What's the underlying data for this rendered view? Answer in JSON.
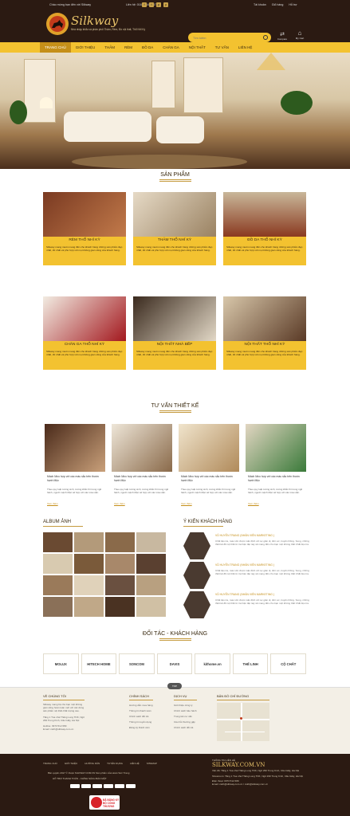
{
  "topbar": {
    "welcome": "Chào mừng bạn đến với Silkway",
    "hotline": "Liên hệ: 0167 244 3737",
    "social": [
      "f",
      "t",
      "p",
      "y"
    ],
    "links": [
      "Tài khoản",
      "Giỏ hàng",
      "Hỗ trợ"
    ]
  },
  "header": {
    "brand": "Silkway",
    "slogan": "Nhà nhập khẩu và phân phối Thảm, Rèm, Đồ nội thất, Thổ Nhĩ Kỳ",
    "search_placeholder": "Tìm kiếm",
    "compare_label": "Compare",
    "cart_label": "My Cart",
    "cart_count": "0"
  },
  "nav": {
    "items": [
      "TRANG CHỦ",
      "GIỚI THIỆU",
      "THẢM",
      "RÈM",
      "ĐỒ DA",
      "CHĂN GA",
      "NỘI THẤT",
      "TƯ VẤN",
      "LIÊN HỆ"
    ],
    "active_index": 0
  },
  "products": {
    "title": "SẢN PHẨM",
    "items": [
      {
        "name": "RÈM THỔ NHĨ KỲ",
        "desc": "Silkway mang muôn mang đến cho khách hàng những sản phẩm đẹp nhất, tốt nhất và phù hợp với mọi không gian sống của khách hàng."
      },
      {
        "name": "THẢM THỔ NHĨ KỲ",
        "desc": "Silkway mang muôn mang đến cho khách hàng những sản phẩm đẹp nhất, tốt nhất và phù hợp với mọi không gian sống của khách hàng."
      },
      {
        "name": "ĐỒ DA THỔ NHĨ KỲ",
        "desc": "Silkway mang muôn mang đến cho khách hàng những sản phẩm đẹp nhất, tốt nhất và phù hợp với mọi không gian sống của khách hàng."
      },
      {
        "name": "CHĂN GA THỔ NHĨ KỲ",
        "desc": "Silkway mang muôn mang đến cho khách hàng những sản phẩm đẹp nhất, tốt nhất và phù hợp với mọi không gian sống của khách hàng."
      },
      {
        "name": "NỘI THẤT NHÀ BẾP",
        "desc": "Silkway mang muôn mang đến cho khách hàng những sản phẩm đẹp nhất, tốt nhất và phù hợp với mọi không gian sống của khách hàng."
      },
      {
        "name": "NỘI THẤT THỔ NHĨ KỲ",
        "desc": "Silkway mang muôn mang đến cho khách hàng những sản phẩm đẹp nhất, tốt nhất và phù hợp với mọi không gian sống của khách hàng."
      }
    ]
  },
  "advice": {
    "title": "TƯ VẤN THIẾT KẾ",
    "items": [
      {
        "title": "Mách Mẹo hợp với các màu sắc trên thước hạnh Mộc",
        "desc": "Theo quy luật tương sinh, tương khắc thì trong ngũ hành, người mệnh Mộc sẽ hợp với các màu sắc.",
        "more": "Xem thêm"
      },
      {
        "title": "Mách Mẹo hợp với các màu sắc trên thước hạnh Mộc",
        "desc": "Theo quy luật tương sinh, tương khắc thì trong ngũ hành, người mệnh Mộc sẽ hợp với các màu sắc.",
        "more": "Xem thêm"
      },
      {
        "title": "Mách Mẹo hợp với các màu sắc trên thước hạnh Mộc",
        "desc": "Theo quy luật tương sinh, tương khắc thì trong ngũ hành, người mệnh Mộc sẽ hợp với các màu sắc.",
        "more": "Xem thêm"
      },
      {
        "title": "Mách Mẹo hợp với các màu sắc trên thước hạnh Mộc",
        "desc": "Theo quy luật tương sinh, tương khắc thì trong ngũ hành, người mệnh Mộc sẽ hợp với các màu sắc.",
        "more": "Xem thêm"
      }
    ]
  },
  "album": {
    "title": "ALBUM ẢNH"
  },
  "feedback": {
    "title": "Ý KIẾN KHÁCH HÀNG",
    "items": [
      {
        "name": "VŨ HUYỀN TRANG (NHÂN VIÊN MARKETING )",
        "text": "Chất liệu tra, màu vốn được mặc định với sự giản dị, đơn sơ, truyền thống. Song, những thiết kế đồ nội thất từ tra hiện đại này sẽ mang đến cho bạn một không thất Chất liệu tra."
      },
      {
        "name": "VŨ HUYỀN TRANG (NHÂN VIÊN MARKETING )",
        "text": "Chất liệu tra, màu vốn được mặc định với sự giản dị, đơn sơ, truyền thống. Song, những thiết kế đồ nội thất từ tra hiện đại này sẽ mang đến cho bạn một không thất Chất liệu tra."
      },
      {
        "name": "VŨ HUYỀN TRANG (NHÂN VIÊN MARKETING )",
        "text": "Chất liệu tra, màu vốn được mặc định với sự giản dị, đơn sơ, truyền thống. Song, những thiết kế đồ nội thất từ tra hiện đại này sẽ mang đến cho bạn một không thất Chất liệu tra."
      }
    ]
  },
  "partners": {
    "title": "ĐỐI TÁC - KHÁCH HÀNG",
    "items": [
      "MOLUX",
      "HITECH HOME",
      "SONCOM",
      "DAVIS",
      "kithome.vn",
      "THẾ LINH",
      "CỘ CHẤT"
    ]
  },
  "footer": {
    "top_label": "TOP",
    "about": {
      "title": "VỀ CHÚNG TÔI",
      "text": "Silkway mang hệ cho bạn một không gian sống hoàn toàn mới với các dòng sản phẩm nội thất chất lượng cao.",
      "address": "Tầng 1 Tòa nhà Thăng Long TDK, Ngõ 299 Trung Kính, Cầu Giấy, Hà Nội",
      "hotline": "Hotline: 0973 512 689",
      "email": "Email: cskh@silkway.com.vn"
    },
    "policy": {
      "title": "CHÍNH SÁCH",
      "items": [
        "Hướng dẫn mua hàng",
        "Thông tin thanh toán",
        "Chính sách đổi trả",
        "Thông tin tuyển dụng",
        "Đăng ký thành viên"
      ]
    },
    "service": {
      "title": "DỊCH VỤ",
      "items": [
        "Giới thiệu công ty",
        "Chính sách bảo hành",
        "Trung tâm tư vấn",
        "Câu hỏi thường gặp",
        "Chính sách đổi trả"
      ]
    },
    "map": {
      "title": "BẢN ĐỒ CHỈ ĐƯỜNG"
    }
  },
  "bottom": {
    "links": [
      "TRANG CHỦ",
      "GIỚI THIỆU",
      "HƯỚNG DẪN",
      "TUYỂN DỤNG",
      "LIÊN HỆ",
      "SITEMAP"
    ],
    "copyright": "Bản quyền 2017 © thuộc SILKWAY.COM.VN Sản phẩm của Hoàn Sức Trang",
    "support": "HỖ TRỢ THANH TOÁN - CHÍNH SÁCH BẢO MẬT",
    "badge": "ĐÃ ĐĂNG KÝ BỘ CÔNG THƯƠNG",
    "info_title": "THÔNG TIN LIÊN HỆ",
    "site": "SILKWAY.COM.VN",
    "office": "Văn đô: Tầng 1 Tòa nhà Thăng Long TDK, Ngõ 299 Trung Kính, Cầu Giấy, Hà Nội",
    "showroom": "Showroom: Tầng 1 Tòa nhà Thăng Long TDK, Ngõ 299 Trung Kính, Cầu Giấy, Hà Nội",
    "phone": "Điện thoại: 0973 512 689",
    "email": "Email: cskh@silkway.com.vn / cskh@silkway.com.vn"
  },
  "colors": {
    "dark": "#2b1a12",
    "accent": "#f3c230",
    "gold": "#c58f19"
  }
}
